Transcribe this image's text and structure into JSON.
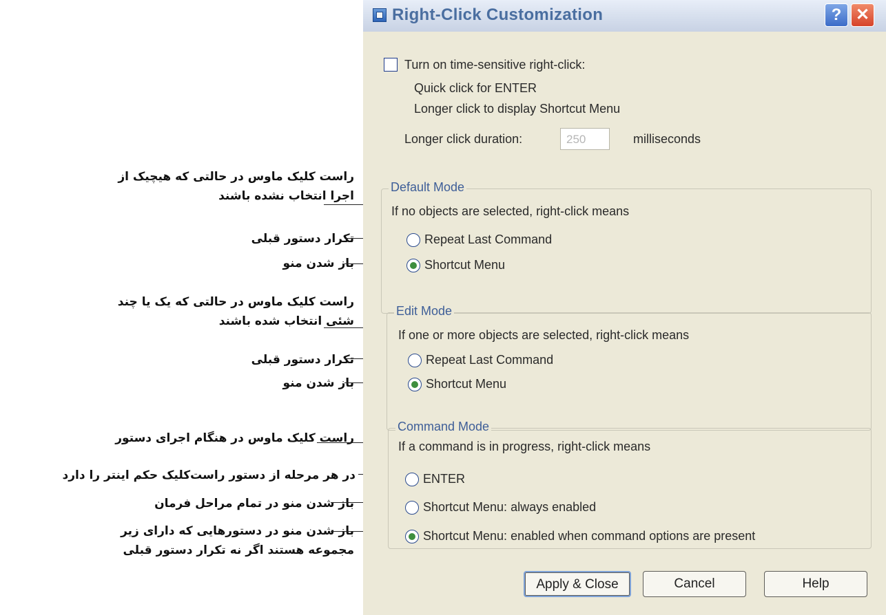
{
  "window": {
    "title": "Right-Click Customization",
    "help_glyph": "?",
    "close_glyph": "✕"
  },
  "time_sensitive": {
    "checkbox_label": "Turn on time-sensitive right-click:",
    "checked": false,
    "line1": "Quick click for ENTER",
    "line2": "Longer click to display Shortcut Menu",
    "duration_label": "Longer click duration:",
    "duration_value": "250",
    "duration_unit": "milliseconds"
  },
  "default_mode": {
    "title": "Default Mode",
    "desc": "If no objects are selected, right-click means",
    "options": [
      {
        "label": "Repeat Last Command",
        "selected": false
      },
      {
        "label": "Shortcut Menu",
        "selected": true
      }
    ]
  },
  "edit_mode": {
    "title": "Edit Mode",
    "desc": "If one or more objects are selected, right-click means",
    "options": [
      {
        "label": "Repeat Last Command",
        "selected": false
      },
      {
        "label": "Shortcut Menu",
        "selected": true
      }
    ]
  },
  "command_mode": {
    "title": "Command Mode",
    "desc": "If a command is in progress, right-click means",
    "options": [
      {
        "label": "ENTER",
        "selected": false
      },
      {
        "label": "Shortcut Menu: always enabled",
        "selected": false
      },
      {
        "label": "Shortcut Menu: enabled when command options are present",
        "selected": true
      }
    ]
  },
  "buttons": {
    "apply": "Apply & Close",
    "cancel": "Cancel",
    "help": "Help"
  },
  "annotations": {
    "default_desc_1": "راست کلیک ماوس در حالتی که هیچیک از",
    "default_desc_2": "اجرا انتخاب نشده باشند",
    "default_repeat": "تکرار دستور قبلی",
    "default_menu": "باز شدن منو",
    "edit_desc_1": "راست کلیک ماوس در حالتی که یک یا چند",
    "edit_desc_2": "شئی  انتخاب شده باشند",
    "edit_repeat": "تکرار دستور قبلی",
    "edit_menu": "باز شدن منو",
    "command_desc": "راست کلیک ماوس در هنگام اجرای دستور",
    "command_enter": "در هر مرحله از دستور راست‌کلیک حکم اینتر را دارد",
    "command_always": "باز شدن منو در تمام مراحل فرمان",
    "command_options_1": "باز شدن منو در دستورهایی که دارای زیر",
    "command_options_2": "مجموعه هستند اگر نه تکرار دستور قبلی"
  }
}
